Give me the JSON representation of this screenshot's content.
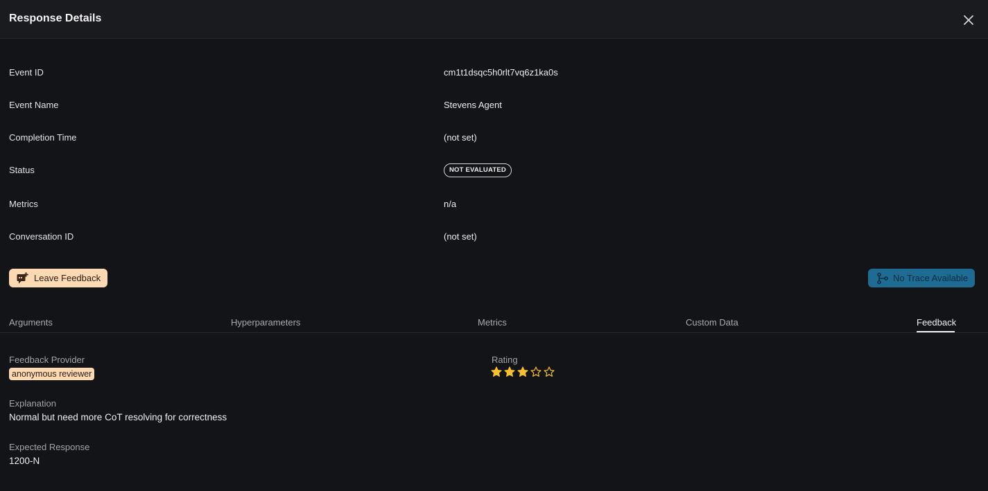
{
  "header": {
    "title": "Response Details"
  },
  "details": [
    {
      "label": "Event ID",
      "value": "cm1t1dsqc5h0rlt7vq6z1ka0s"
    },
    {
      "label": "Event Name",
      "value": "Stevens Agent"
    },
    {
      "label": "Completion Time",
      "value": "(not set)"
    },
    {
      "label": "Status",
      "value": "NOT EVALUATED"
    },
    {
      "label": "Metrics",
      "value": "n/a"
    },
    {
      "label": "Conversation ID",
      "value": "(not set)"
    }
  ],
  "actions": {
    "leave_feedback": "Leave Feedback",
    "no_trace": "No Trace Available"
  },
  "tabs": [
    {
      "label": "Arguments",
      "active": false
    },
    {
      "label": "Hyperparameters",
      "active": false
    },
    {
      "label": "Metrics",
      "active": false
    },
    {
      "label": "Custom Data",
      "active": false
    },
    {
      "label": "Feedback",
      "active": true
    }
  ],
  "feedback": {
    "provider_label": "Feedback Provider",
    "provider_value": "anonymous reviewer",
    "rating_label": "Rating",
    "rating": 3,
    "rating_max": 5,
    "explanation_label": "Explanation",
    "explanation_value": "Normal but need more CoT resolving for correctness",
    "expected_label": "Expected Response",
    "expected_value": "1200-N"
  },
  "colors": {
    "background": "#131418",
    "feedback_button": "#fcd8b3",
    "trace_button": "#1e6b93",
    "star": "#f5c02c"
  },
  "icons": {
    "close": "close-icon",
    "feedback": "feedback-icon",
    "trace": "branch-icon",
    "star": "star-icon"
  }
}
